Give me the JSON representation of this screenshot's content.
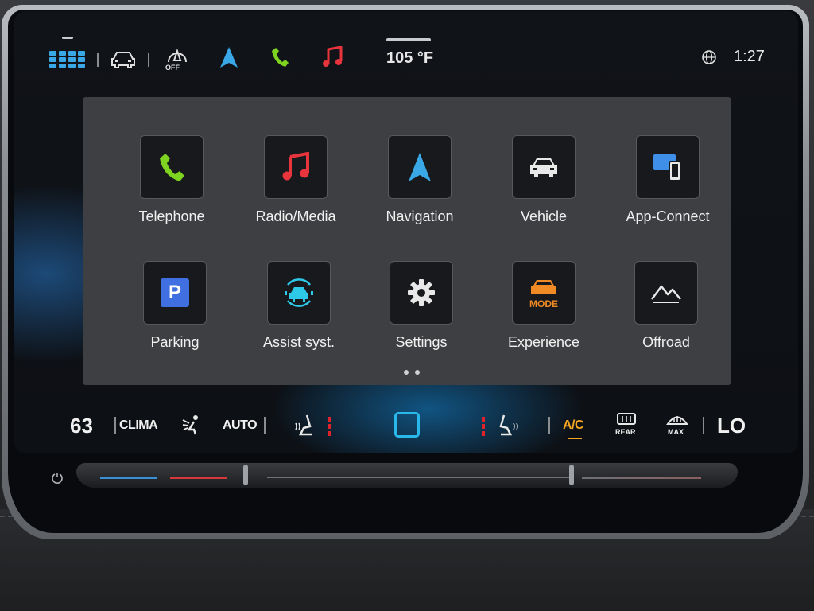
{
  "status_bar": {
    "outside_temp": "105 °F",
    "time": "1:27",
    "icons": [
      "apps-grid-icon",
      "car-icon",
      "assist-off-icon",
      "navigation-arrow-icon",
      "phone-icon",
      "music-note-icon",
      "globe-icon"
    ],
    "assist_off_label": "OFF"
  },
  "apps": [
    {
      "label": "Telephone",
      "icon": "phone-icon"
    },
    {
      "label": "Radio/Media",
      "icon": "music-note-icon"
    },
    {
      "label": "Navigation",
      "icon": "navigation-arrow-icon"
    },
    {
      "label": "Vehicle",
      "icon": "car-icon"
    },
    {
      "label": "App-Connect",
      "icon": "app-connect-icon"
    },
    {
      "label": "Parking",
      "icon": "parking-icon",
      "badge": "P"
    },
    {
      "label": "Assist syst.",
      "icon": "assist-systems-icon"
    },
    {
      "label": "Settings",
      "icon": "gear-icon"
    },
    {
      "label": "Experience",
      "icon": "experience-mode-icon",
      "badge": "MODE"
    },
    {
      "label": "Offroad",
      "icon": "mountain-icon"
    }
  ],
  "page_indicator": {
    "pages": 2,
    "current": 1
  },
  "climate": {
    "left_temp": "63",
    "clima_label": "CLIMA",
    "auto_label": "AUTO",
    "ac_label": "A/C",
    "rear_label": "REAR",
    "max_label": "MAX",
    "right_temp": "LO"
  },
  "colors": {
    "accent_blue": "#29b8ea",
    "phone_green": "#7ed321",
    "media_red": "#e8343c",
    "ac_orange": "#f5a623",
    "mode_orange": "#f08a24",
    "parking_blue": "#3f6fe0",
    "seat_heat_red": "#e0222a"
  }
}
